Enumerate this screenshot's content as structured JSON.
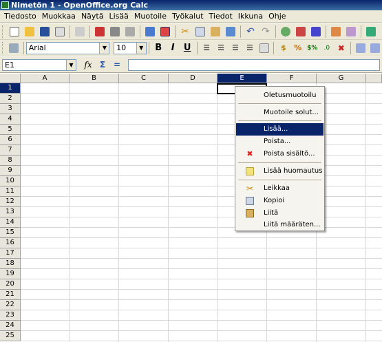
{
  "window": {
    "title": "Nimetön 1 - OpenOffice.org Calc"
  },
  "menubar": {
    "items": [
      "Tiedosto",
      "Muokkaa",
      "Näytä",
      "Lisää",
      "Muotoile",
      "Työkalut",
      "Tiedot",
      "Ikkuna",
      "Ohje"
    ]
  },
  "format_toolbar": {
    "font_name": "Arial",
    "font_size": "10",
    "bold_label": "B",
    "italic_label": "I",
    "underline_label": "U"
  },
  "formula_bar": {
    "name_box": "E1",
    "func_glyph": "fx",
    "sum_glyph": "Σ",
    "equals_glyph": "=",
    "input_value": ""
  },
  "sheet": {
    "columns": [
      "A",
      "B",
      "C",
      "D",
      "E",
      "F",
      "G"
    ],
    "selected_column": "E",
    "rows": [
      "1",
      "2",
      "3",
      "4",
      "5",
      "6",
      "7",
      "8",
      "9",
      "10",
      "11",
      "12",
      "13",
      "14",
      "15",
      "16",
      "17",
      "18",
      "19",
      "20",
      "21",
      "22",
      "23",
      "24",
      "25"
    ],
    "selected_row": "1"
  },
  "context_menu": {
    "items": [
      {
        "label": "Oletusmuotoilu",
        "icon": ""
      },
      {
        "label": "Muotoile solut...",
        "icon": ""
      },
      {
        "label": "Lisää...",
        "icon": ""
      },
      {
        "label": "Poista...",
        "icon": ""
      },
      {
        "label": "Poista sisältö...",
        "icon": "delete-x-icon"
      },
      {
        "label": "Lisää huomautus",
        "icon": "note-icon"
      },
      {
        "label": "Leikkaa",
        "icon": "scissors-icon"
      },
      {
        "label": "Kopioi",
        "icon": "copy-icon"
      },
      {
        "label": "Liitä",
        "icon": "paste-icon"
      },
      {
        "label": "Liitä määräten...",
        "icon": ""
      }
    ],
    "highlighted_item": "Lisää..."
  },
  "colors": {
    "selection": "#0a246a",
    "toolbar_bg": "#ece9d8",
    "delete_red": "#d22"
  }
}
